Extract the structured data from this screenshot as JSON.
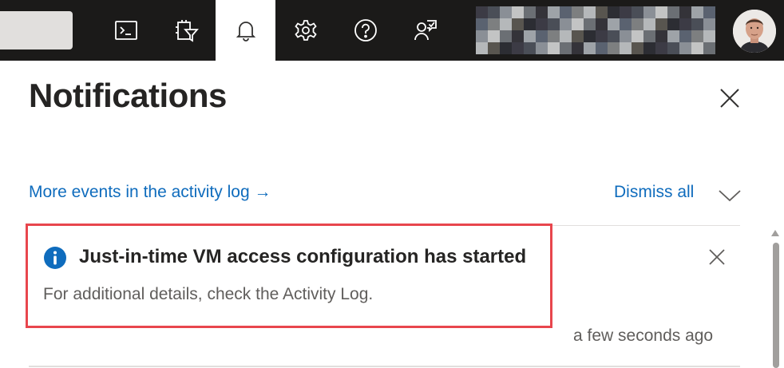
{
  "topbar": {
    "icons": {
      "cloudshell": "cloud-shell-icon",
      "filter": "directory-filter-icon",
      "notifications": "bell-icon",
      "settings": "gear-icon",
      "help": "help-icon",
      "feedback": "feedback-icon"
    },
    "active_icon": "bell-icon",
    "background": "#1b1a19"
  },
  "panel": {
    "title": "Notifications",
    "more_events": "More events in the activity log →",
    "dismiss_all": "Dismiss all"
  },
  "notification": {
    "title": "Just-in-time VM access configuration has started",
    "body": "For additional details, check the Activity Log.",
    "time": "a few seconds ago",
    "icon": "info-icon",
    "highlight_color": "#e8464d"
  },
  "colors": {
    "link": "#0f6cbd",
    "info": "#0f6cbd"
  }
}
